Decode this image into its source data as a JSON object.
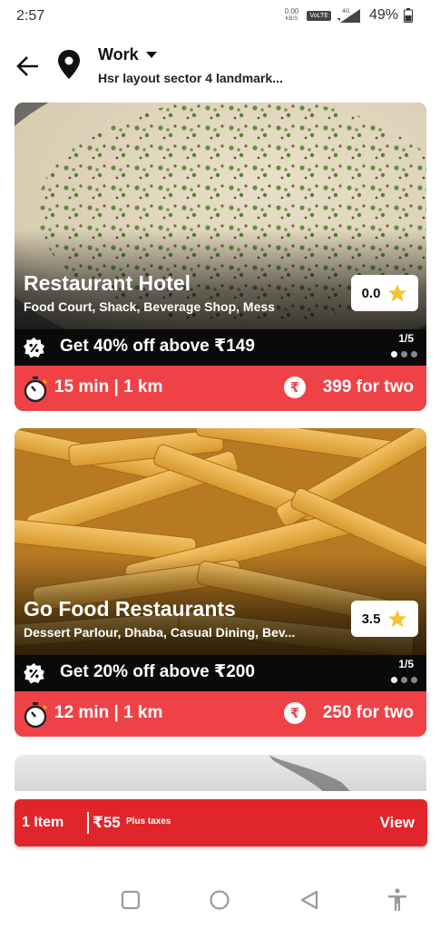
{
  "status_bar": {
    "time": "2:57",
    "net_speed": "0.00",
    "net_unit": "KB/S",
    "volte": "VoLTE",
    "network": "4G",
    "battery": "49%"
  },
  "header": {
    "location_label": "Work",
    "address": "Hsr layout sector 4 landmark..."
  },
  "restaurants": [
    {
      "name": "Restaurant Hotel",
      "cuisines": "Food Court, Shack, Beverage Shop, Mess",
      "rating": "0.0",
      "offer": "Get 40% off above ₹149",
      "page": "1/5",
      "time_distance": "15 min | 1 km",
      "cost": "399 for two"
    },
    {
      "name": "Go Food Restaurants",
      "cuisines": "Dessert Parlour, Dhaba, Casual Dining, Bev...",
      "rating": "3.5",
      "offer": "Get 20% off above ₹200",
      "page": "1/5",
      "time_distance": "12 min | 1 km",
      "cost": "250 for two"
    }
  ],
  "cart": {
    "item_count": "1 Item",
    "total": "₹55",
    "taxes_note": "Plus taxes",
    "view_label": "View"
  },
  "colors": {
    "accent_red": "#ef4247",
    "cart_red": "#e0262b",
    "star_yellow": "#f4c430"
  },
  "icons": [
    "back-arrow-icon",
    "location-pin-icon",
    "caret-down-icon",
    "discount-badge-icon",
    "star-icon",
    "timer-icon",
    "rupee-icon",
    "square-nav-icon",
    "circle-nav-icon",
    "triangle-back-nav-icon",
    "accessibility-icon"
  ]
}
